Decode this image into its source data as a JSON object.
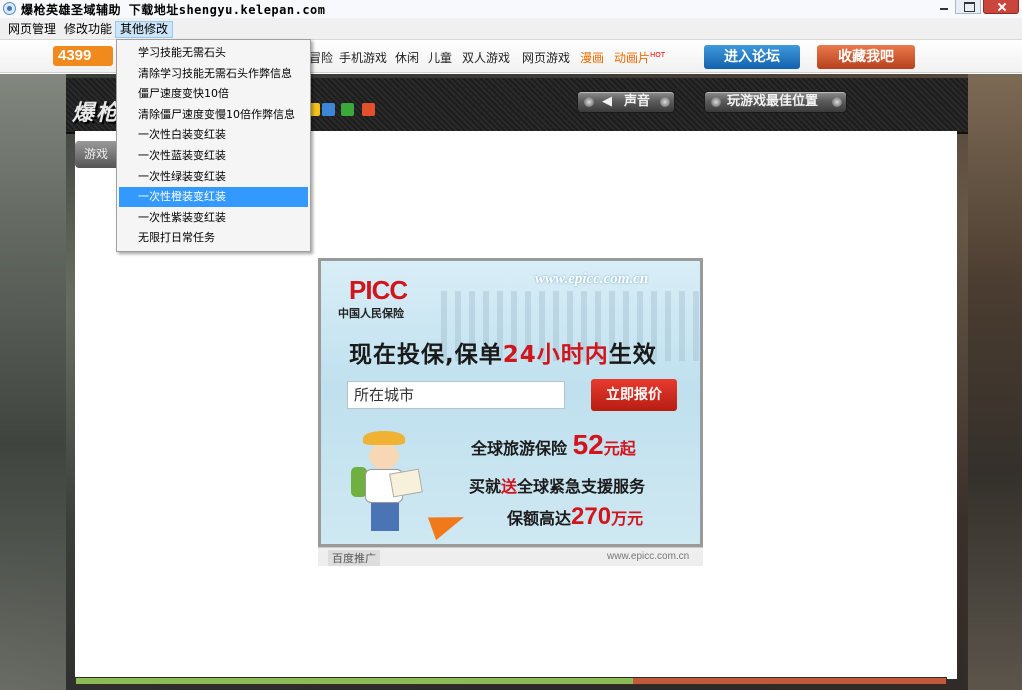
{
  "window": {
    "title": "爆枪英雄圣域辅助  下载地址shengyu.kelepan.com"
  },
  "menubar": {
    "items": [
      "网页管理",
      "修改功能",
      "其他修改"
    ],
    "active_index": 2
  },
  "dropdown": {
    "items": [
      "学习技能无需石头",
      "清除学习技能无需石头作弊信息",
      "僵尸速度变快10倍",
      "清除僵尸速度变慢10倍作弊信息",
      "一次性白装变红装",
      "一次性蓝装变红装",
      "一次性绿装变红装",
      "一次性橙装变红装",
      "一次性紫装变红装",
      "无限打日常任务"
    ],
    "selected_index": 7
  },
  "nav": {
    "logo": "4399",
    "links": [
      "冒险",
      "手机游戏",
      "休闲",
      "儿童",
      "双人游戏",
      "网页游戏",
      "漫画",
      "动画片"
    ],
    "hot_badge": "HOT",
    "forum_button": "进入论坛",
    "favorite_button": "收藏我吧"
  },
  "game": {
    "logo_text": "爆枪",
    "sound_button": "声音",
    "best_position_button": "玩游戏最佳位置",
    "tab_label": "游戏"
  },
  "ad": {
    "brand": "PICC",
    "brand_subtitle": "中国人民保险",
    "url_top": "www.epicc.com.cn",
    "headline_pre": "现在投保,保单",
    "headline_red": "24小时内",
    "headline_post": "生效",
    "city_placeholder": "所在城市",
    "quote_button": "立即报价",
    "line1_pre": "全球旅游保险",
    "line1_num": "52",
    "line1_post": "元起",
    "line2_pre": "买就",
    "line2_red": "送",
    "line2_post": "全球紧急支援服务",
    "line3_pre": "保额高达",
    "line3_num": "270",
    "line3_post": "万元",
    "footer_baidu": "百度推广",
    "footer_domain": "www.epicc.com.cn"
  },
  "loading": {
    "progress": 0.64,
    "fill_color": "#8cbb5a",
    "track_color": "#c05a3a"
  },
  "colors": {
    "selection": "#3399ff",
    "menu_active": "#cce4f7",
    "forum_blue": "#1262ad",
    "fav_orange": "#b6401c"
  }
}
